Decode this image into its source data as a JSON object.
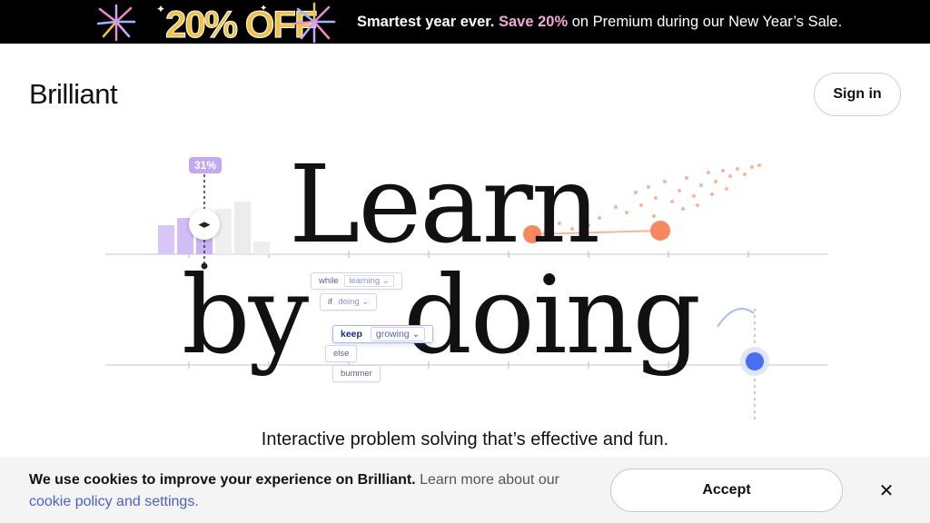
{
  "promo": {
    "art_text": "20% OFF",
    "headline_bold": "Smartest year ever.",
    "headline_accent": "Save 20%",
    "headline_rest": "on Premium during our New Year’s Sale.",
    "accent_color": "#f5a7d6",
    "gold_color": "#f2c14a"
  },
  "header": {
    "logo": "Brilliant",
    "signin_label": "Sign in"
  },
  "hero": {
    "line1": "Learn",
    "line2_word1": "by",
    "line2_word2": "doing",
    "slider_percent": "31%",
    "slider_level": 0.31,
    "handle_icon": "◂▸",
    "chips": {
      "while": "while",
      "learning": "learning ⌄",
      "if": "if",
      "doing": "doing ⌄",
      "keep": "keep",
      "growing": "growing ⌄",
      "else": "else",
      "bummer": "bummer"
    },
    "accent_orange": "#f7875f",
    "accent_blue": "#4a6ef0",
    "accent_purple": "#c4a9f2"
  },
  "tagline": "Interactive problem solving that’s effective and fun.",
  "cookie": {
    "bold": "We use cookies to improve your experience on Brilliant.",
    "muted": "Learn more about our",
    "link": "cookie policy and settings.",
    "accept_label": "Accept",
    "close_icon": "✕"
  }
}
